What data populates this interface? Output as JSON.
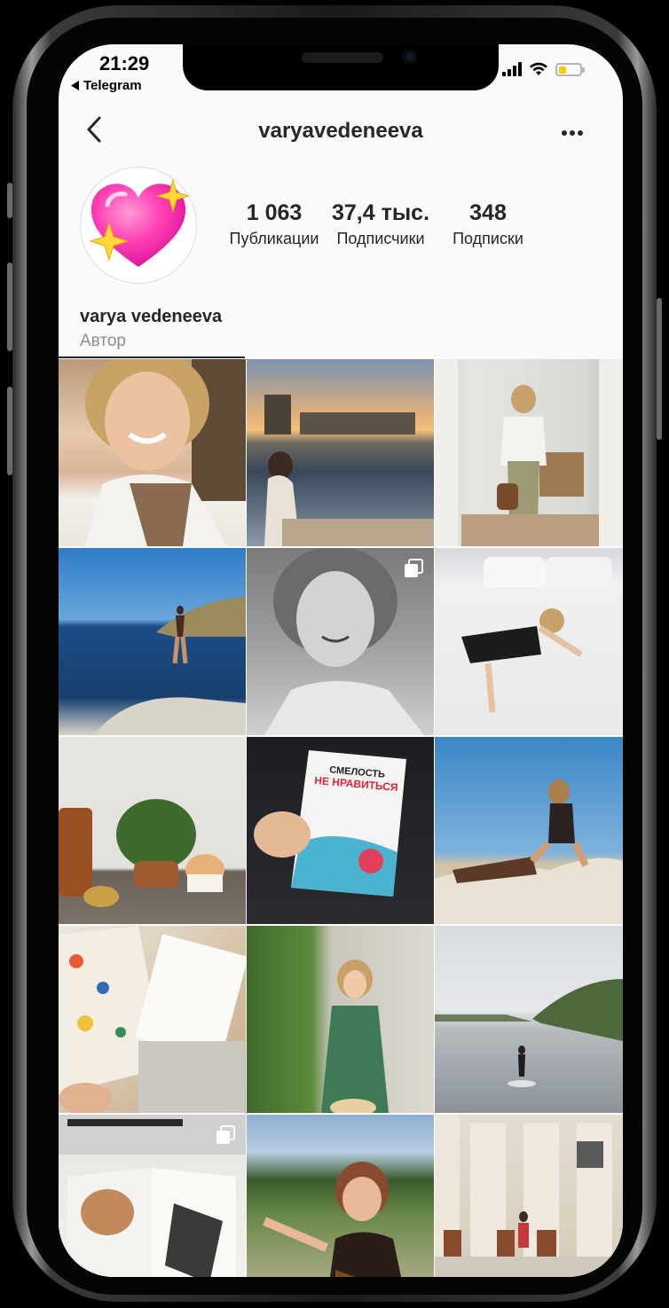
{
  "status_bar": {
    "time": "21:29",
    "back_app": "Telegram",
    "battery_level": 0.35
  },
  "header": {
    "username": "varyavedeneeva",
    "back_icon": "chevron-left-icon",
    "more_icon": "more-horizontal-icon"
  },
  "profile": {
    "avatar_icon": "sparkling-heart-emoji",
    "stats": [
      {
        "value": "1 063",
        "label": "Публикации"
      },
      {
        "value": "37,4 тыс.",
        "label": "Подписчики"
      },
      {
        "value": "348",
        "label": "Подписки"
      }
    ],
    "full_name": "varya vedeneeva",
    "category": "Автор"
  },
  "posts": [
    {
      "name": "post-smiling-portrait",
      "multi": false
    },
    {
      "name": "post-river-sunset",
      "multi": false
    },
    {
      "name": "post-mirror-outfit",
      "multi": false
    },
    {
      "name": "post-sea-cliff",
      "multi": false
    },
    {
      "name": "post-bw-portrait",
      "multi": true
    },
    {
      "name": "post-bed",
      "multi": false
    },
    {
      "name": "post-plant-candle",
      "multi": false
    },
    {
      "name": "post-book",
      "multi": false,
      "book_title_line1": "СМЕЛОСТЬ",
      "book_title_line2": "НЕ НРАВИТЬСЯ"
    },
    {
      "name": "post-beach-rocks",
      "multi": false
    },
    {
      "name": "post-notebooks",
      "multi": false
    },
    {
      "name": "post-green-dress",
      "multi": false
    },
    {
      "name": "post-paddleboard",
      "multi": false
    },
    {
      "name": "post-laptop-magazine",
      "multi": true
    },
    {
      "name": "post-park-selfie",
      "multi": false
    },
    {
      "name": "post-building",
      "multi": false
    }
  ]
}
